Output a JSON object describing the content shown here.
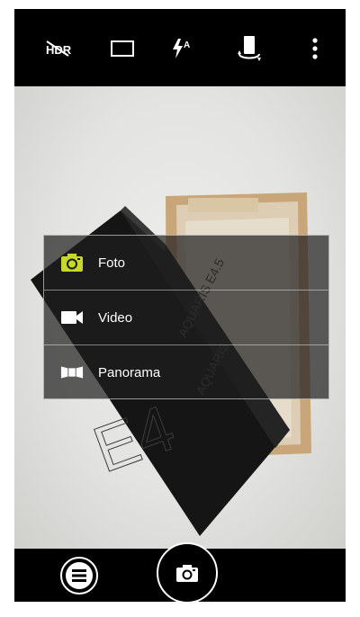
{
  "topbar": {
    "icons": [
      "hdr-off-icon",
      "aspect-ratio-icon",
      "flash-auto-icon",
      "switch-camera-icon",
      "more-vert-icon"
    ],
    "flash_label": "A"
  },
  "mode_menu": {
    "items": [
      {
        "label": "Foto",
        "icon": "photo-camera-icon",
        "selected": true,
        "accent": "#c6d92b"
      },
      {
        "label": "Video",
        "icon": "videocam-icon",
        "selected": false
      },
      {
        "label": "Panorama",
        "icon": "panorama-icon",
        "selected": false
      }
    ]
  },
  "bottombar": {
    "left_button_icon": "menu-icon",
    "shutter_icon": "camera-shutter-icon"
  },
  "colors": {
    "accent": "#c6d92b",
    "bar_background": "#000000"
  }
}
